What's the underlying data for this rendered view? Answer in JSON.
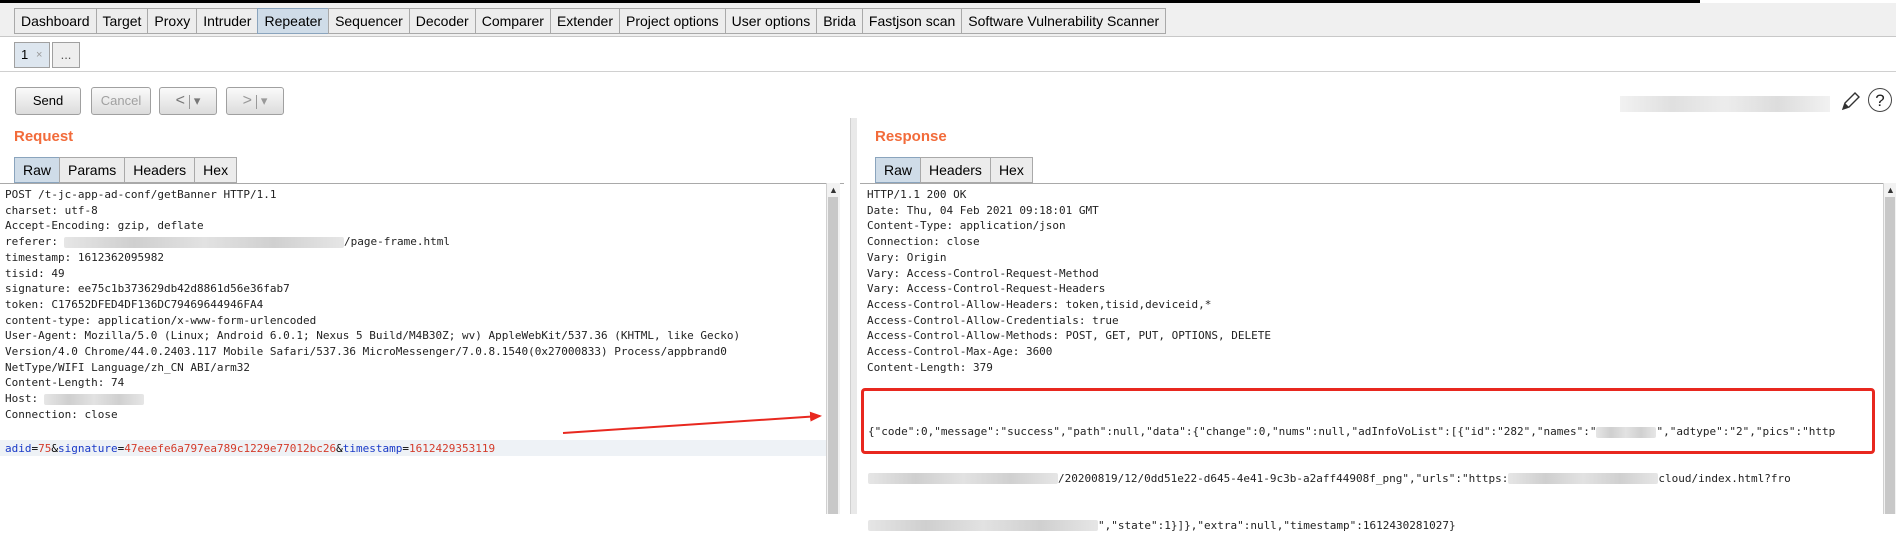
{
  "top_tabs": [
    "Dashboard",
    "Target",
    "Proxy",
    "Intruder",
    "Repeater",
    "Sequencer",
    "Decoder",
    "Comparer",
    "Extender",
    "Project options",
    "User options",
    "Brida",
    "Fastjson scan",
    "Software Vulnerability Scanner"
  ],
  "active_top_tab": "Repeater",
  "repeater_tabs": {
    "current": "1",
    "close": "×",
    "more": "..."
  },
  "toolbar": {
    "send": "Send",
    "cancel": "Cancel",
    "back": "<",
    "forward": ">",
    "dropdown": "▾",
    "help": "?"
  },
  "request": {
    "title": "Request",
    "tabs": [
      "Raw",
      "Params",
      "Headers",
      "Hex"
    ],
    "active_tab": "Raw",
    "lines": [
      "POST /t-jc-app-ad-conf/getBanner HTTP/1.1",
      "charset: utf-8",
      "Accept-Encoding: gzip, deflate",
      "referer:",
      "timestamp: 1612362095982",
      "tisid: 49",
      "signature: ee75c1b373629db42d8861d56e36fab7",
      "token: C17652DFED4DF136DC79469644946FA4",
      "content-type: application/x-www-form-urlencoded",
      "User-Agent: Mozilla/5.0 (Linux; Android 6.0.1; Nexus 5 Build/M4B30Z; wv) AppleWebKit/537.36 (KHTML, like Gecko)",
      "Version/4.0 Chrome/44.0.2403.117 Mobile Safari/537.36 MicroMessenger/7.0.8.1540(0x27000833) Process/appbrand0",
      "NetType/WIFI Language/zh_CN ABI/arm32",
      "Content-Length: 74",
      "Host:",
      "Connection: close"
    ],
    "referer_suffix": "/page-frame.html",
    "body": [
      {
        "key": "adid",
        "value": "75"
      },
      {
        "key": "signature",
        "value": "47eeefe6a797ea789c1229e77012bc26"
      },
      {
        "key": "timestamp",
        "value": "1612429353119"
      }
    ]
  },
  "response": {
    "title": "Response",
    "tabs": [
      "Raw",
      "Headers",
      "Hex"
    ],
    "active_tab": "Raw",
    "lines": [
      "HTTP/1.1 200 OK",
      "Date: Thu, 04 Feb 2021 09:18:01 GMT",
      "Content-Type: application/json",
      "Connection: close",
      "Vary: Origin",
      "Vary: Access-Control-Request-Method",
      "Vary: Access-Control-Request-Headers",
      "Access-Control-Allow-Headers: token,tisid,deviceid,*",
      "Access-Control-Allow-Credentials: true",
      "Access-Control-Allow-Methods: POST, GET, PUT, OPTIONS, DELETE",
      "Access-Control-Max-Age: 3600",
      "Content-Length: 379"
    ],
    "json": {
      "line1": "{\"code\":0,\"message\":\"success\",\"path\":null,\"data\":{\"change\":0,\"nums\":null,\"adInfoVoList\":[{\"id\":\"282\",\"names\":\"",
      "line1b": "\",\"adtype\":\"2\",\"pics\":\"http",
      "line2a": "/20200819/12/0dd51e22-d645-4e41-9c3b-a2aff44908f_png\",\"urls\":\"https:",
      "line2b": "cloud/index.html?fro",
      "line3a": "\",\"state\":1}]},\"extra\":null,\"timestamp\":1612430281027}"
    }
  },
  "colors": {
    "accent_title": "#f26b3a",
    "highlight_box": "#e8281f",
    "param_key": "#1a3ac8",
    "param_value": "#d43b2a"
  }
}
